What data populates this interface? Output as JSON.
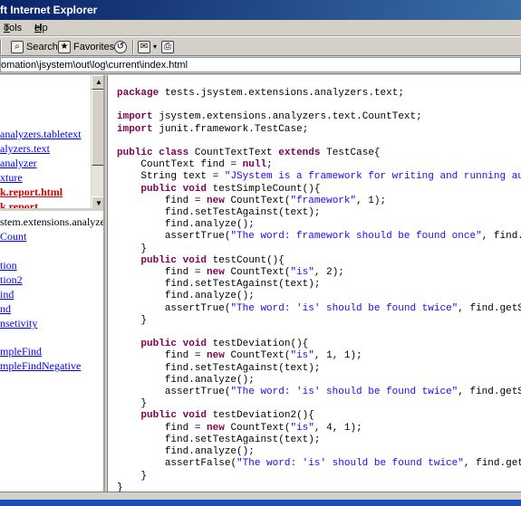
{
  "window": {
    "title": "ft Internet Explorer"
  },
  "menu": {
    "tools": "Tools",
    "help": "Help"
  },
  "toolbar": {
    "search": "Search",
    "favorites": "Favorites"
  },
  "address": {
    "value": "omation\\jsystem\\out\\log\\current\\index.html"
  },
  "left_top": {
    "items": [
      {
        "label": "analyzers.tabletext",
        "style": "link"
      },
      {
        "label": "alyzers.text",
        "style": "link"
      },
      {
        "label": "analyzer",
        "style": "link"
      },
      {
        "label": "xture",
        "style": "link"
      },
      {
        "label": "k.report.html",
        "style": "red"
      },
      {
        "label": "k.report",
        "style": "red"
      }
    ]
  },
  "left_bottom": {
    "items": [
      {
        "label": "stem.extensions.analyze",
        "style": "plain"
      },
      {
        "label": "Count",
        "style": "link"
      },
      {
        "label": "tion",
        "style": "link"
      },
      {
        "label": "tion2",
        "style": "link"
      },
      {
        "label": "ind",
        "style": "link"
      },
      {
        "label": "nd",
        "style": "link"
      },
      {
        "label": "nsetivity",
        "style": "link"
      },
      {
        "label": "mpleFind",
        "style": "link"
      },
      {
        "label": "mpleFindNegative",
        "style": "link"
      }
    ]
  },
  "code": {
    "lines": [
      "package tests.jsystem.extensions.analyzers.text;",
      "",
      "import jsystem.extensions.analyzers.text.CountText;",
      "import junit.framework.TestCase;",
      "",
      "public class CountTextText extends TestCase{",
      "    CountText find = null;",
      "    String text = \"JSystem is a framework for writing and running au",
      "    public void testSimpleCount(){",
      "        find = new CountText(\"framework\", 1);",
      "        find.setTestAgainst(text);",
      "        find.analyze();",
      "        assertTrue(\"The word: framework should be found once\", find.",
      "    }",
      "    public void testCount(){",
      "        find = new CountText(\"is\", 2);",
      "        find.setTestAgainst(text);",
      "        find.analyze();",
      "        assertTrue(\"The word: 'is' should be found twice\", find.getS",
      "    }",
      "",
      "    public void testDeviation(){",
      "        find = new CountText(\"is\", 1, 1);",
      "        find.setTestAgainst(text);",
      "        find.analyze();",
      "        assertTrue(\"The word: 'is' should be found twice\", find.getS",
      "    }",
      "    public void testDeviation2(){",
      "        find = new CountText(\"is\", 4, 1);",
      "        find.setTestAgainst(text);",
      "        find.analyze();",
      "        assertFalse(\"The word: 'is' should be found twice\", find.get",
      "    }",
      "}"
    ]
  }
}
